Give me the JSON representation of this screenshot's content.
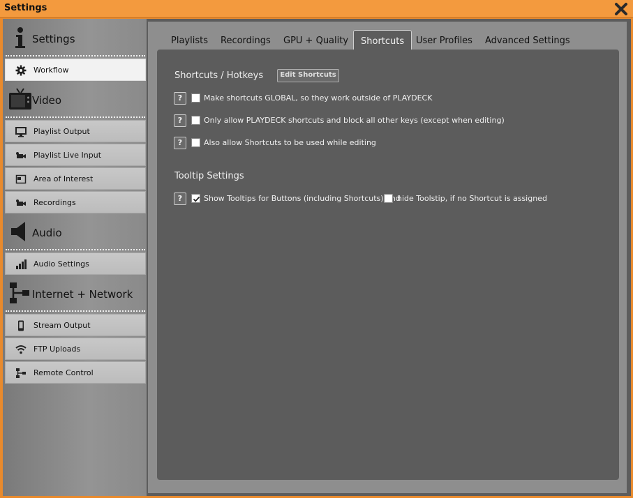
{
  "window": {
    "title": "Settings"
  },
  "sidebar": {
    "sections": [
      {
        "label": "Settings",
        "icon": "info-icon"
      },
      {
        "label": "Video",
        "icon": "tv-icon"
      },
      {
        "label": "Audio",
        "icon": "speaker-icon"
      },
      {
        "label": "Internet + Network",
        "icon": "network-icon"
      }
    ],
    "items": [
      {
        "label": "Workflow",
        "icon": "gear-icon",
        "active": true
      },
      {
        "label": "Playlist Output",
        "icon": "monitor-icon"
      },
      {
        "label": "Playlist Live Input",
        "icon": "camera-icon"
      },
      {
        "label": "Area of Interest",
        "icon": "frame-icon"
      },
      {
        "label": "Recordings",
        "icon": "camera-icon"
      },
      {
        "label": "Audio Settings",
        "icon": "bars-icon"
      },
      {
        "label": "Stream Output",
        "icon": "phone-icon"
      },
      {
        "label": "FTP Uploads",
        "icon": "wifi-icon"
      },
      {
        "label": "Remote Control",
        "icon": "network-icon"
      }
    ]
  },
  "tabs": [
    {
      "label": "Playlists"
    },
    {
      "label": "Recordings"
    },
    {
      "label": "GPU + Quality"
    },
    {
      "label": "Shortcuts",
      "active": true
    },
    {
      "label": "User Profiles"
    },
    {
      "label": "Advanced Settings"
    }
  ],
  "shortcuts": {
    "heading": "Shortcuts / Hotkeys",
    "edit_button": "Edit Shortcuts",
    "options": [
      {
        "help": "?",
        "label": "Make shortcuts GLOBAL, so they work outside of PLAYDECK",
        "checked": false
      },
      {
        "help": "?",
        "label": "Only allow PLAYDECK shortcuts and block all other keys (except when editing)",
        "checked": false
      },
      {
        "help": "?",
        "label": "Also allow Shortcuts to be used while editing",
        "checked": false
      }
    ]
  },
  "tooltips": {
    "heading": "Tooltip Settings",
    "help": "?",
    "show_label": "Show Tooltips for Buttons (including Shortcuts) and",
    "show_checked": true,
    "hide_label": "hide Toolstip, if no Shortcut is assigned",
    "hide_checked": false
  },
  "colors": {
    "titlebar": "#f39a3e",
    "panel": "#5c5c5c",
    "accent": "#e88a2d"
  }
}
